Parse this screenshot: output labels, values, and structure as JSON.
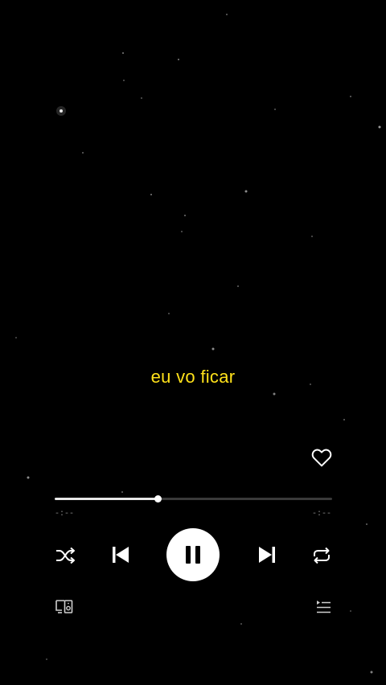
{
  "lyric": {
    "text": "eu vo ficar",
    "color": "#ffe11a"
  },
  "player": {
    "liked": false,
    "progress_fraction": 0.37,
    "elapsed": "-:--",
    "remaining": "-:--",
    "state": "playing"
  },
  "icons": {
    "like": "heart-icon",
    "shuffle": "shuffle-icon",
    "previous": "skip-previous-icon",
    "play_pause": "pause-icon",
    "next": "skip-next-icon",
    "repeat": "repeat-icon",
    "devices": "connect-devices-icon",
    "queue": "queue-icon"
  }
}
